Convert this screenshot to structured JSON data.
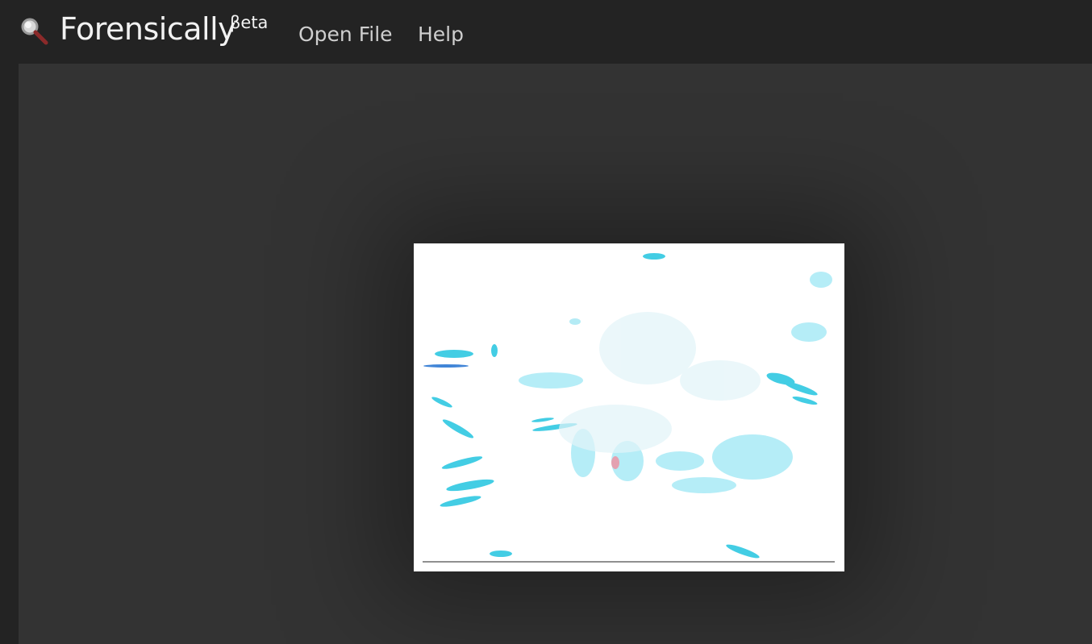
{
  "app": {
    "title": "Forensically",
    "badge": "βeta"
  },
  "nav": {
    "open_file": "Open File",
    "help": "Help"
  },
  "icons": {
    "logo": "magnifier-icon"
  },
  "colors": {
    "header_bg": "#232323",
    "workspace_bg": "#333333",
    "title_text": "#f2f2f2",
    "nav_text": "#cfcfcf",
    "highlight": "#1fc9e6"
  }
}
